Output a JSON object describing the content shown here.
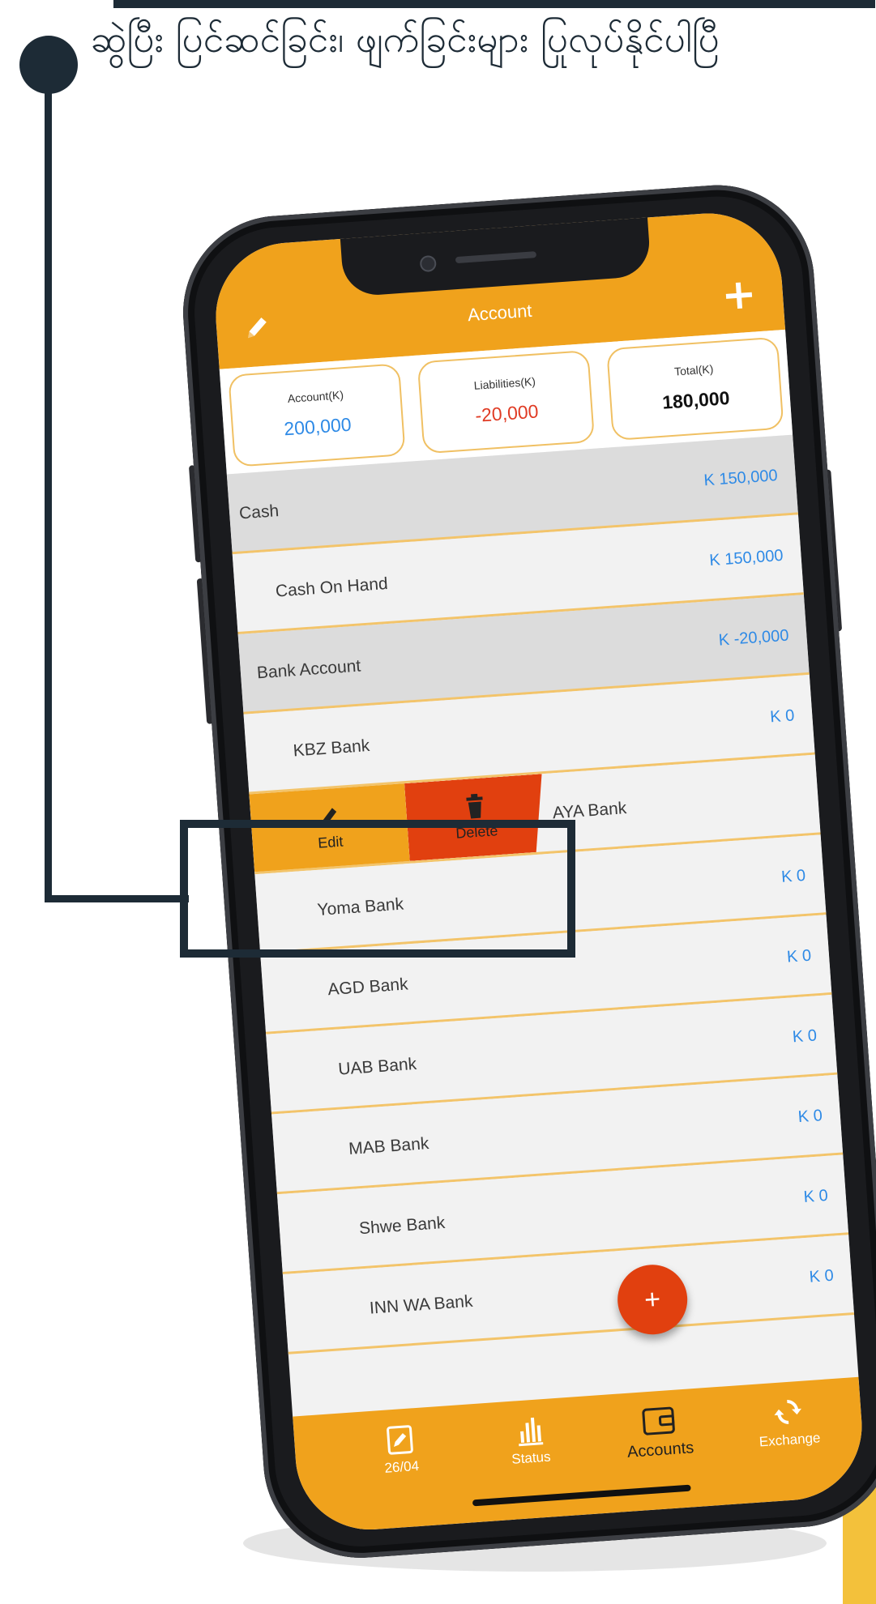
{
  "callout": {
    "caption": "ဆွဲပြီး ပြင်ဆင်ခြင်း၊ ဖျက်ခြင်းများ ပြုလုပ်နိုင်ပါပြီ"
  },
  "header": {
    "title": "Account"
  },
  "summary": [
    {
      "label": "Account(K)",
      "value": "200,000",
      "color": "#2e8ae6"
    },
    {
      "label": "Liabilities(K)",
      "value": "-20,000",
      "color": "#e03b24"
    },
    {
      "label": "Total(K)",
      "value": "180,000",
      "color": "#111111"
    }
  ],
  "rows": [
    {
      "name": "Cash",
      "amount": "K 150,000",
      "group": true
    },
    {
      "name": "Cash On Hand",
      "amount": "K 150,000",
      "group": false
    },
    {
      "name": "Bank Account",
      "amount": "K -20,000",
      "group": true
    },
    {
      "name": "KBZ Bank",
      "amount": "K 0",
      "group": false
    },
    {
      "name": "AYA Bank",
      "amount": "",
      "group": false
    },
    {
      "name": "Yoma Bank",
      "amount": "K 0",
      "group": false
    },
    {
      "name": "AGD Bank",
      "amount": "K 0",
      "group": false
    },
    {
      "name": "UAB Bank",
      "amount": "K 0",
      "group": false
    },
    {
      "name": "MAB Bank",
      "amount": "K 0",
      "group": false
    },
    {
      "name": "Shwe Bank",
      "amount": "K 0",
      "group": false
    },
    {
      "name": "INN WA Bank",
      "amount": "K 0",
      "group": false
    }
  ],
  "swipe": {
    "edit_label": "Edit",
    "delete_label": "Delete"
  },
  "fab": {
    "label": "+"
  },
  "nav": [
    {
      "label": "26/04",
      "icon": "calendar-icon"
    },
    {
      "label": "Status",
      "icon": "chart-icon"
    },
    {
      "label": "Accounts",
      "icon": "wallet-icon",
      "active": true
    },
    {
      "label": "Exchange",
      "icon": "sync-icon"
    }
  ],
  "colors": {
    "accent": "#f0a21c",
    "danger": "#e1400f",
    "link": "#2e8ae6",
    "callout": "#1d2b36"
  }
}
